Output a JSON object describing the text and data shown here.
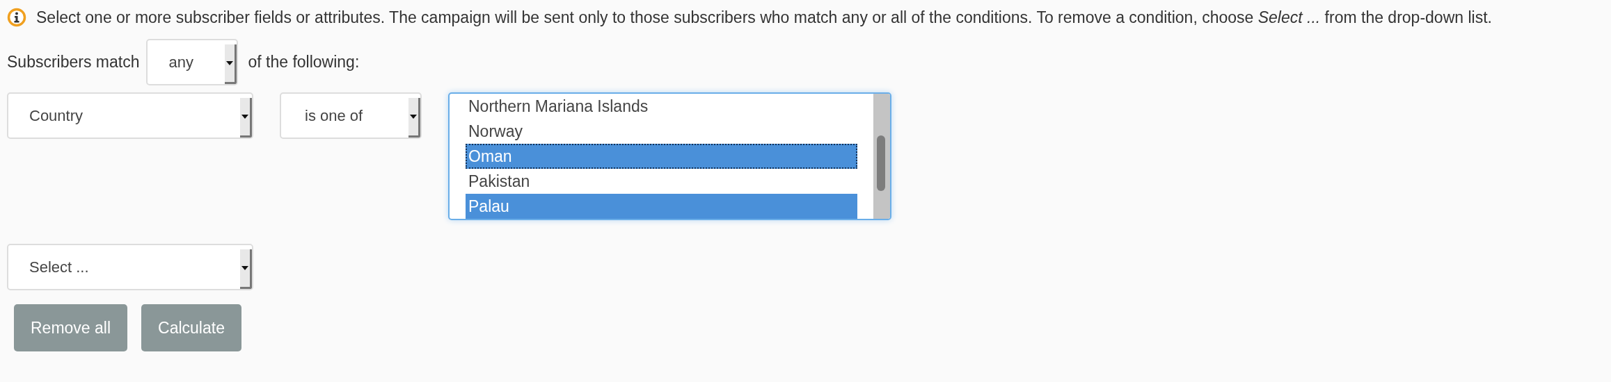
{
  "info": {
    "text": "Select one or more subscriber fields or attributes. The campaign will be sent only to those subscribers who match any or all of the conditions. To remove a condition, choose *Select ...* from the drop-down list."
  },
  "match_line": {
    "prefix": "Subscribers match",
    "select": {
      "value": "any"
    },
    "suffix": "of the following:"
  },
  "conditions": [
    {
      "field": {
        "value": "Country"
      },
      "operator": {
        "value": "is one of"
      },
      "values": {
        "items": [
          {
            "label": "Northern Mariana Islands",
            "selected": false,
            "focused": false
          },
          {
            "label": "Norway",
            "selected": false,
            "focused": false
          },
          {
            "label": "Oman",
            "selected": true,
            "focused": true
          },
          {
            "label": "Pakistan",
            "selected": false,
            "focused": false
          },
          {
            "label": "Palau",
            "selected": true,
            "focused": false
          }
        ]
      }
    },
    {
      "field": {
        "value": "Select ..."
      }
    }
  ],
  "buttons": [
    {
      "label": "Remove all"
    },
    {
      "label": "Calculate"
    }
  ]
}
